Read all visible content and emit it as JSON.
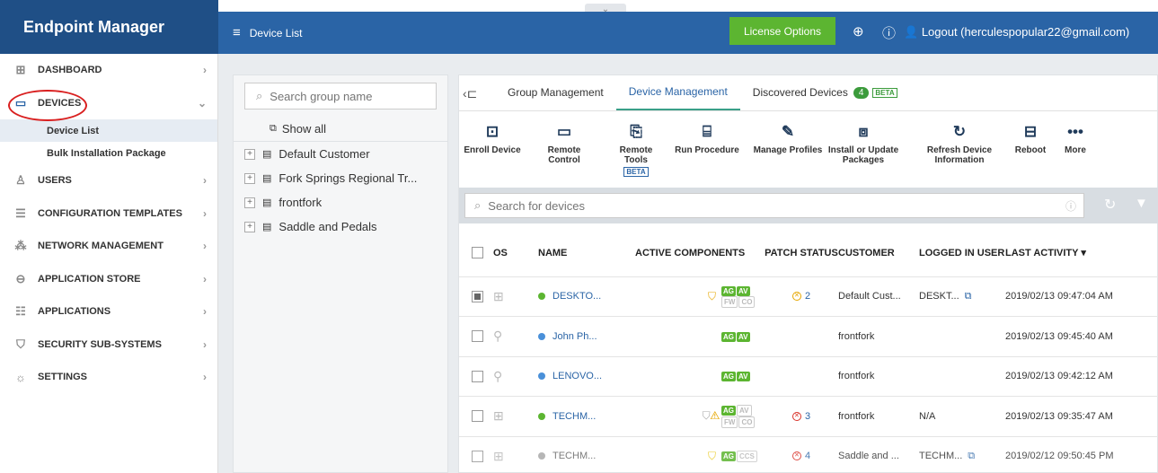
{
  "app": {
    "brand": "Endpoint Manager"
  },
  "topbar": {
    "title": "Device List",
    "license_label": "License Options",
    "logout_label": "Logout (herculespopular22@gmail.com)"
  },
  "sidebar": {
    "items": [
      {
        "label": "DASHBOARD",
        "icon": "dashboard-icon"
      },
      {
        "label": "DEVICES",
        "icon": "devices-icon"
      },
      {
        "label": "USERS",
        "icon": "users-icon"
      },
      {
        "label": "CONFIGURATION TEMPLATES",
        "icon": "templates-icon"
      },
      {
        "label": "NETWORK MANAGEMENT",
        "icon": "network-icon"
      },
      {
        "label": "APPLICATION STORE",
        "icon": "store-icon"
      },
      {
        "label": "APPLICATIONS",
        "icon": "applications-icon"
      },
      {
        "label": "SECURITY SUB-SYSTEMS",
        "icon": "security-icon"
      },
      {
        "label": "SETTINGS",
        "icon": "settings-icon"
      }
    ],
    "sub_items": [
      {
        "label": "Device List"
      },
      {
        "label": "Bulk Installation Package"
      }
    ]
  },
  "groups": {
    "search_placeholder": "Search group name",
    "show_all": "Show all",
    "items": [
      {
        "label": "Default Customer"
      },
      {
        "label": "Fork Springs Regional Tr..."
      },
      {
        "label": "frontfork"
      },
      {
        "label": "Saddle and Pedals"
      }
    ]
  },
  "tabs": [
    {
      "label": "Group Management"
    },
    {
      "label": "Device Management"
    },
    {
      "label": "Discovered Devices",
      "count": "4",
      "badge": "BETA"
    }
  ],
  "toolbar": [
    {
      "label": "Enroll Device",
      "icon": "enroll-icon"
    },
    {
      "label": "Remote Control",
      "icon": "laptop-icon"
    },
    {
      "label": "Remote Tools",
      "icon": "remote-tools-icon",
      "badge": "BETA"
    },
    {
      "label": "Run Procedure",
      "icon": "procedure-icon"
    },
    {
      "label": "Manage Profiles",
      "icon": "profiles-icon"
    },
    {
      "label": "Install or Update Packages",
      "icon": "package-icon"
    },
    {
      "label": "Refresh Device Information",
      "icon": "refresh-icon"
    },
    {
      "label": "Reboot",
      "icon": "reboot-icon"
    },
    {
      "label": "More",
      "icon": "more-icon"
    }
  ],
  "device_search": {
    "placeholder": "Search for devices"
  },
  "table": {
    "columns": [
      "OS",
      "NAME",
      "ACTIVE COMPONENTS",
      "PATCH STATUS",
      "CUSTOMER",
      "LOGGED IN USER",
      "LAST ACTIVITY"
    ],
    "rows": [
      {
        "os": "windows",
        "status_color": "#5cb531",
        "name": "DESKTO...",
        "patch": "2",
        "patch_color": "#e6a700",
        "customer": "Default Cust...",
        "user": "DESKT...",
        "last": "2019/02/13 09:47:04 AM"
      },
      {
        "os": "android",
        "status_color": "#4a90d9",
        "name": "John Ph...",
        "patch": "",
        "patch_color": "",
        "customer": "frontfork",
        "user": "",
        "last": "2019/02/13 09:45:40 AM"
      },
      {
        "os": "android",
        "status_color": "#4a90d9",
        "name": "LENOVO...",
        "patch": "",
        "patch_color": "",
        "customer": "frontfork",
        "user": "",
        "last": "2019/02/13 09:42:12 AM"
      },
      {
        "os": "windows",
        "status_color": "#5cb531",
        "name": "TECHM...",
        "patch": "3",
        "patch_color": "#d9342b",
        "customer": "frontfork",
        "user": "N/A",
        "last": "2019/02/13 09:35:47 AM"
      },
      {
        "os": "windows",
        "status_color": "#aaaaaa",
        "name": "TECHM...",
        "patch": "4",
        "patch_color": "#d9342b",
        "customer": "Saddle and ...",
        "user": "TECHM...",
        "last": "2019/02/12 09:50:45 PM"
      }
    ]
  },
  "colors": {
    "brand": "#1f4f86",
    "topbar": "#2a64a6",
    "license": "#5cb531",
    "annotation": "#d92020"
  }
}
